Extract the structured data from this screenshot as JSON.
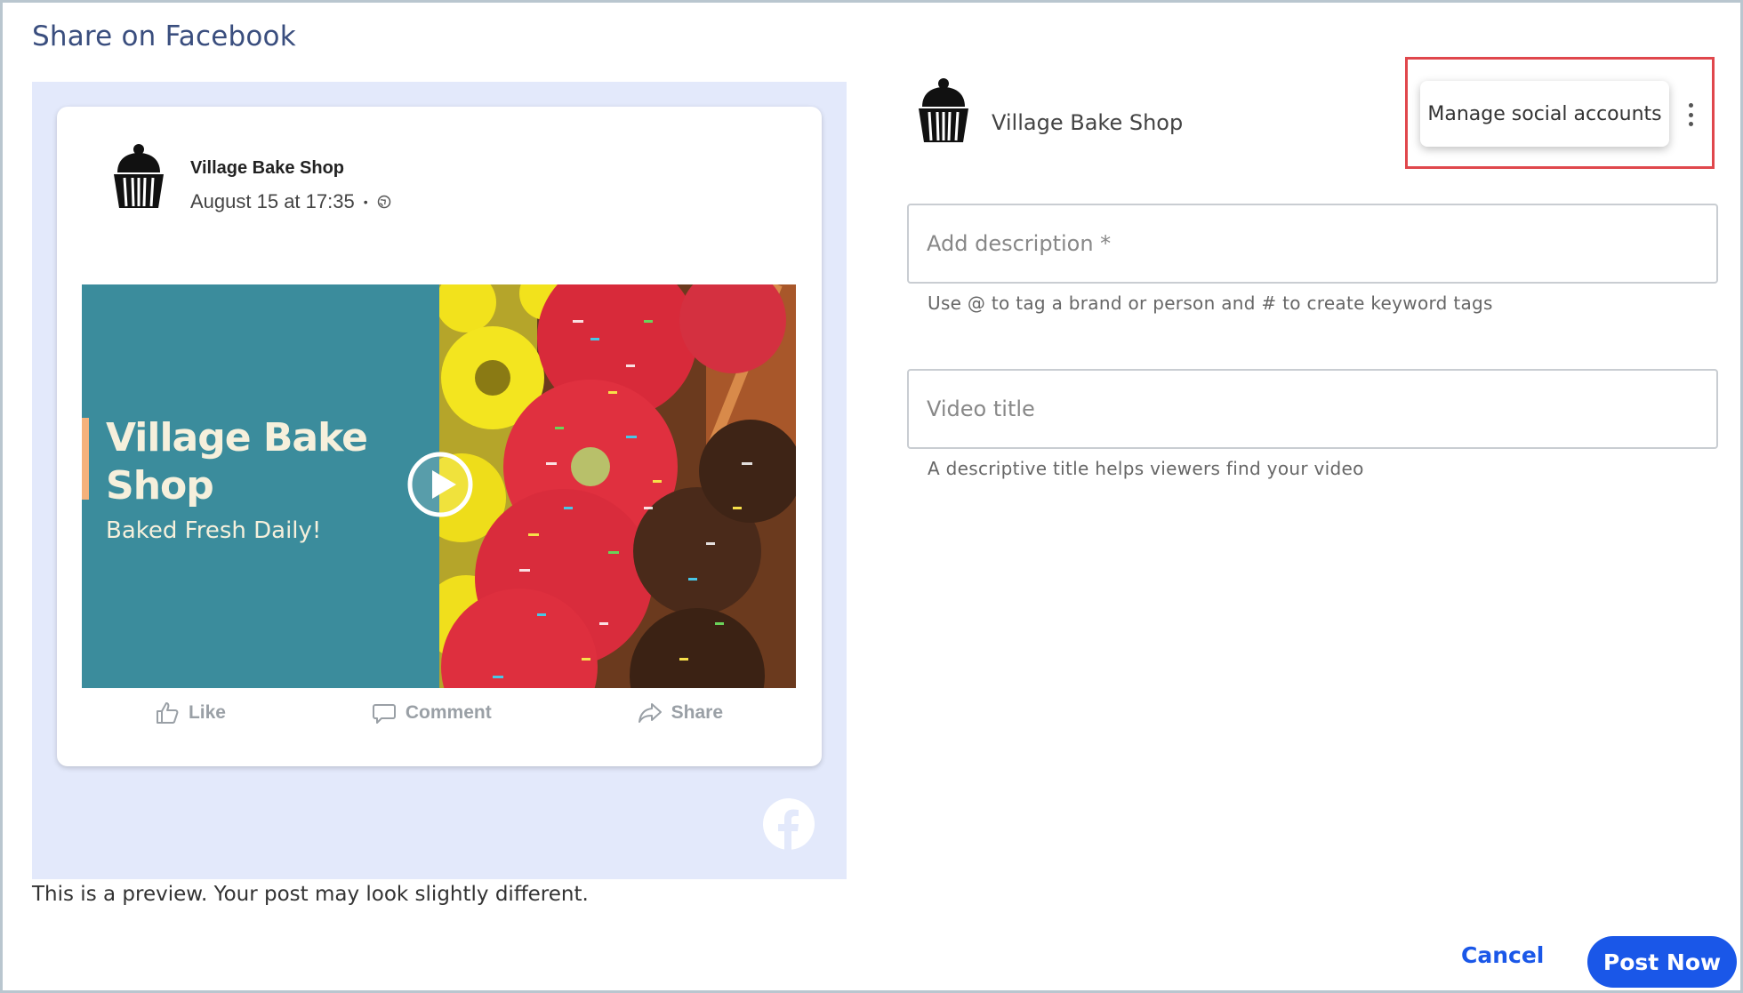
{
  "dialog": {
    "title": "Share on Facebook"
  },
  "preview": {
    "post": {
      "account_name": "Village Bake Shop",
      "timestamp": "August 15 at 17:35",
      "separator": "•",
      "media": {
        "headline": "Village Bake Shop",
        "subheadline": "Baked Fresh Daily!"
      },
      "actions": [
        {
          "label": "Like",
          "icon": "thumbs-up-icon"
        },
        {
          "label": "Comment",
          "icon": "comment-icon"
        },
        {
          "label": "Share",
          "icon": "share-icon"
        }
      ]
    },
    "note": "This is a preview. Your post may look slightly different."
  },
  "account": {
    "name": "Village Bake Shop",
    "menu_item": "Manage social accounts"
  },
  "form": {
    "description": {
      "placeholder": "Add description *",
      "value": "",
      "helper": "Use @ to tag a brand or person and # to create keyword tags"
    },
    "video_title": {
      "placeholder": "Video title",
      "value": "",
      "helper": "A descriptive title helps viewers find your video"
    }
  },
  "buttons": {
    "cancel": "Cancel",
    "post_now": "Post Now"
  },
  "colors": {
    "title": "#3a4e7e",
    "preview_background": "#e3e9fb",
    "media_panel": "#3b8c9c",
    "primary": "#1a57e8",
    "highlight": "#e0474c"
  }
}
